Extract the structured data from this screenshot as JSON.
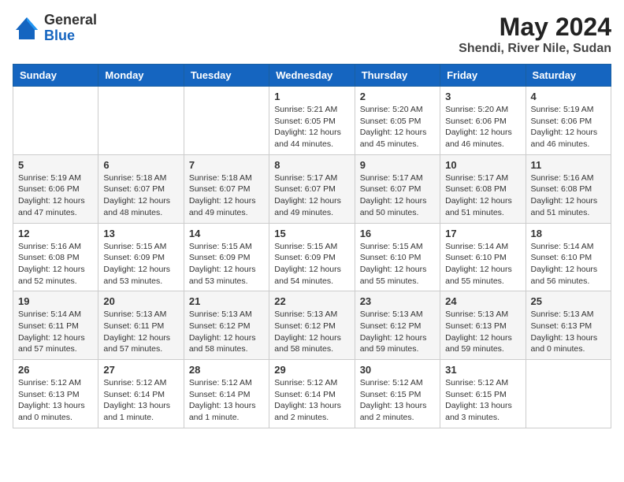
{
  "logo": {
    "general": "General",
    "blue": "Blue"
  },
  "header": {
    "month": "May 2024",
    "location": "Shendi, River Nile, Sudan"
  },
  "weekdays": [
    "Sunday",
    "Monday",
    "Tuesday",
    "Wednesday",
    "Thursday",
    "Friday",
    "Saturday"
  ],
  "weeks": [
    [
      {
        "day": "",
        "sunrise": "",
        "sunset": "",
        "daylight": ""
      },
      {
        "day": "",
        "sunrise": "",
        "sunset": "",
        "daylight": ""
      },
      {
        "day": "",
        "sunrise": "",
        "sunset": "",
        "daylight": ""
      },
      {
        "day": "1",
        "sunrise": "Sunrise: 5:21 AM",
        "sunset": "Sunset: 6:05 PM",
        "daylight": "Daylight: 12 hours and 44 minutes."
      },
      {
        "day": "2",
        "sunrise": "Sunrise: 5:20 AM",
        "sunset": "Sunset: 6:05 PM",
        "daylight": "Daylight: 12 hours and 45 minutes."
      },
      {
        "day": "3",
        "sunrise": "Sunrise: 5:20 AM",
        "sunset": "Sunset: 6:06 PM",
        "daylight": "Daylight: 12 hours and 46 minutes."
      },
      {
        "day": "4",
        "sunrise": "Sunrise: 5:19 AM",
        "sunset": "Sunset: 6:06 PM",
        "daylight": "Daylight: 12 hours and 46 minutes."
      }
    ],
    [
      {
        "day": "5",
        "sunrise": "Sunrise: 5:19 AM",
        "sunset": "Sunset: 6:06 PM",
        "daylight": "Daylight: 12 hours and 47 minutes."
      },
      {
        "day": "6",
        "sunrise": "Sunrise: 5:18 AM",
        "sunset": "Sunset: 6:07 PM",
        "daylight": "Daylight: 12 hours and 48 minutes."
      },
      {
        "day": "7",
        "sunrise": "Sunrise: 5:18 AM",
        "sunset": "Sunset: 6:07 PM",
        "daylight": "Daylight: 12 hours and 49 minutes."
      },
      {
        "day": "8",
        "sunrise": "Sunrise: 5:17 AM",
        "sunset": "Sunset: 6:07 PM",
        "daylight": "Daylight: 12 hours and 49 minutes."
      },
      {
        "day": "9",
        "sunrise": "Sunrise: 5:17 AM",
        "sunset": "Sunset: 6:07 PM",
        "daylight": "Daylight: 12 hours and 50 minutes."
      },
      {
        "day": "10",
        "sunrise": "Sunrise: 5:17 AM",
        "sunset": "Sunset: 6:08 PM",
        "daylight": "Daylight: 12 hours and 51 minutes."
      },
      {
        "day": "11",
        "sunrise": "Sunrise: 5:16 AM",
        "sunset": "Sunset: 6:08 PM",
        "daylight": "Daylight: 12 hours and 51 minutes."
      }
    ],
    [
      {
        "day": "12",
        "sunrise": "Sunrise: 5:16 AM",
        "sunset": "Sunset: 6:08 PM",
        "daylight": "Daylight: 12 hours and 52 minutes."
      },
      {
        "day": "13",
        "sunrise": "Sunrise: 5:15 AM",
        "sunset": "Sunset: 6:09 PM",
        "daylight": "Daylight: 12 hours and 53 minutes."
      },
      {
        "day": "14",
        "sunrise": "Sunrise: 5:15 AM",
        "sunset": "Sunset: 6:09 PM",
        "daylight": "Daylight: 12 hours and 53 minutes."
      },
      {
        "day": "15",
        "sunrise": "Sunrise: 5:15 AM",
        "sunset": "Sunset: 6:09 PM",
        "daylight": "Daylight: 12 hours and 54 minutes."
      },
      {
        "day": "16",
        "sunrise": "Sunrise: 5:15 AM",
        "sunset": "Sunset: 6:10 PM",
        "daylight": "Daylight: 12 hours and 55 minutes."
      },
      {
        "day": "17",
        "sunrise": "Sunrise: 5:14 AM",
        "sunset": "Sunset: 6:10 PM",
        "daylight": "Daylight: 12 hours and 55 minutes."
      },
      {
        "day": "18",
        "sunrise": "Sunrise: 5:14 AM",
        "sunset": "Sunset: 6:10 PM",
        "daylight": "Daylight: 12 hours and 56 minutes."
      }
    ],
    [
      {
        "day": "19",
        "sunrise": "Sunrise: 5:14 AM",
        "sunset": "Sunset: 6:11 PM",
        "daylight": "Daylight: 12 hours and 57 minutes."
      },
      {
        "day": "20",
        "sunrise": "Sunrise: 5:13 AM",
        "sunset": "Sunset: 6:11 PM",
        "daylight": "Daylight: 12 hours and 57 minutes."
      },
      {
        "day": "21",
        "sunrise": "Sunrise: 5:13 AM",
        "sunset": "Sunset: 6:12 PM",
        "daylight": "Daylight: 12 hours and 58 minutes."
      },
      {
        "day": "22",
        "sunrise": "Sunrise: 5:13 AM",
        "sunset": "Sunset: 6:12 PM",
        "daylight": "Daylight: 12 hours and 58 minutes."
      },
      {
        "day": "23",
        "sunrise": "Sunrise: 5:13 AM",
        "sunset": "Sunset: 6:12 PM",
        "daylight": "Daylight: 12 hours and 59 minutes."
      },
      {
        "day": "24",
        "sunrise": "Sunrise: 5:13 AM",
        "sunset": "Sunset: 6:13 PM",
        "daylight": "Daylight: 12 hours and 59 minutes."
      },
      {
        "day": "25",
        "sunrise": "Sunrise: 5:13 AM",
        "sunset": "Sunset: 6:13 PM",
        "daylight": "Daylight: 13 hours and 0 minutes."
      }
    ],
    [
      {
        "day": "26",
        "sunrise": "Sunrise: 5:12 AM",
        "sunset": "Sunset: 6:13 PM",
        "daylight": "Daylight: 13 hours and 0 minutes."
      },
      {
        "day": "27",
        "sunrise": "Sunrise: 5:12 AM",
        "sunset": "Sunset: 6:14 PM",
        "daylight": "Daylight: 13 hours and 1 minute."
      },
      {
        "day": "28",
        "sunrise": "Sunrise: 5:12 AM",
        "sunset": "Sunset: 6:14 PM",
        "daylight": "Daylight: 13 hours and 1 minute."
      },
      {
        "day": "29",
        "sunrise": "Sunrise: 5:12 AM",
        "sunset": "Sunset: 6:14 PM",
        "daylight": "Daylight: 13 hours and 2 minutes."
      },
      {
        "day": "30",
        "sunrise": "Sunrise: 5:12 AM",
        "sunset": "Sunset: 6:15 PM",
        "daylight": "Daylight: 13 hours and 2 minutes."
      },
      {
        "day": "31",
        "sunrise": "Sunrise: 5:12 AM",
        "sunset": "Sunset: 6:15 PM",
        "daylight": "Daylight: 13 hours and 3 minutes."
      },
      {
        "day": "",
        "sunrise": "",
        "sunset": "",
        "daylight": ""
      }
    ]
  ]
}
